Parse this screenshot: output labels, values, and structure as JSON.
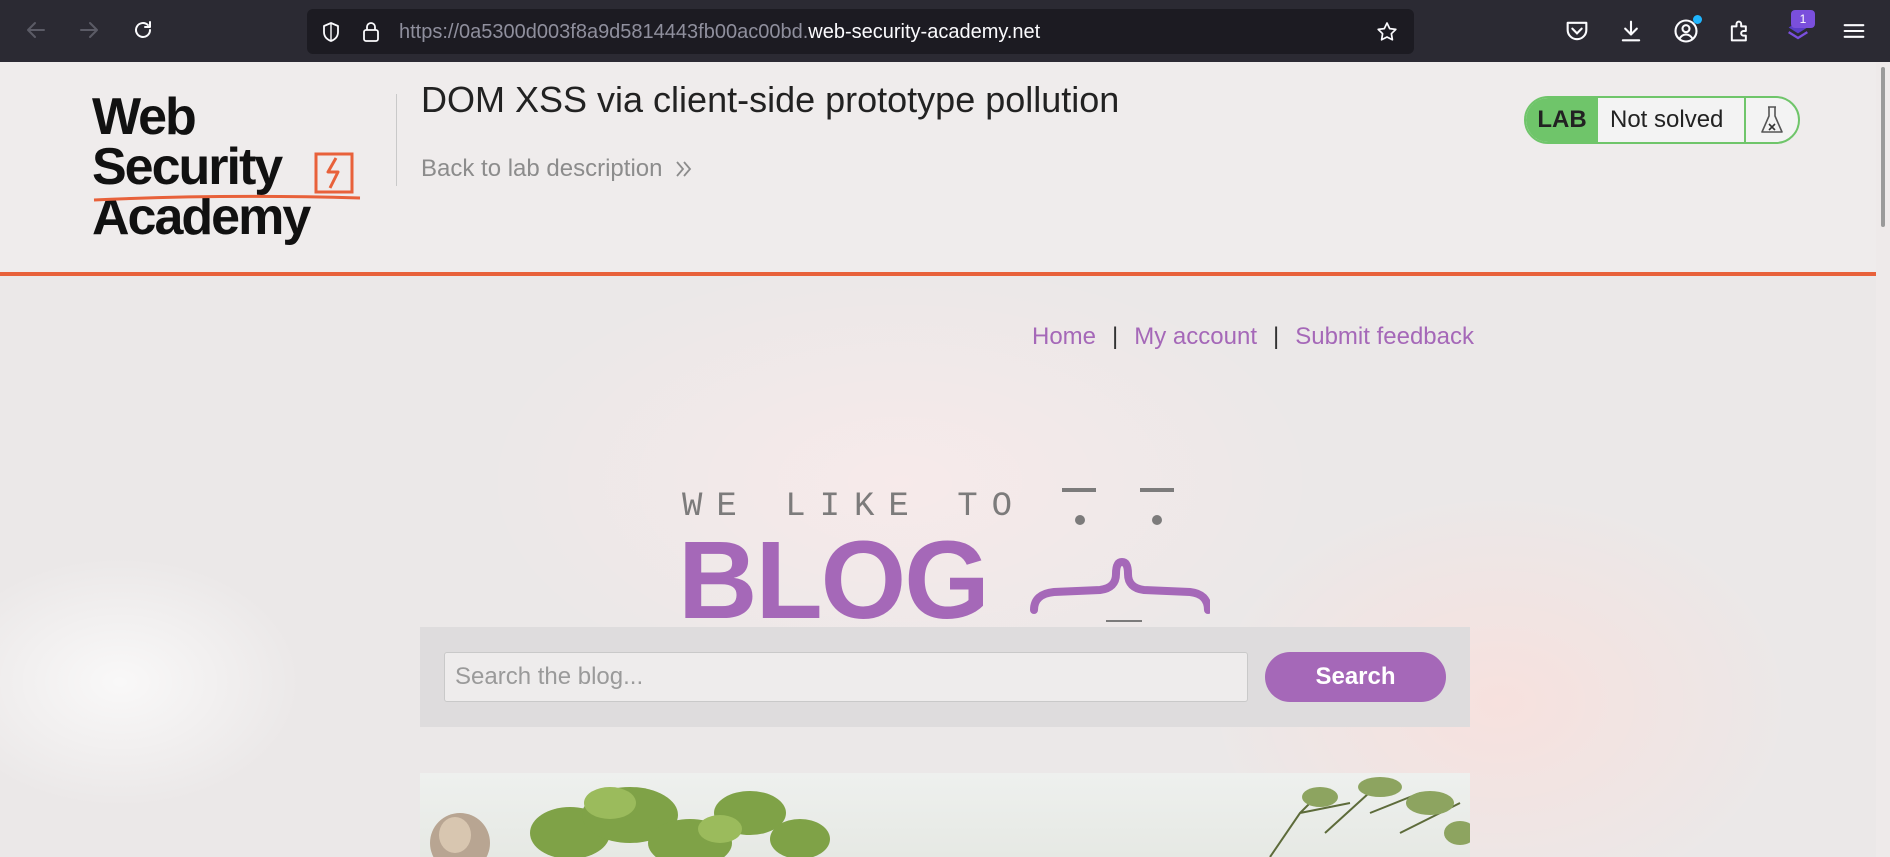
{
  "browser": {
    "url_prefix": "https://0a5300d003f8a9d5814443fb00ac00bd.",
    "url_host": "web-security-academy.net",
    "extensions_badge": "1"
  },
  "header": {
    "logo_line1": "Web Security",
    "logo_line2": "Academy",
    "lab_title": "DOM XSS via client-side prototype pollution",
    "back_link": "Back to lab description",
    "lab_badge": "LAB",
    "status": "Not solved",
    "accent_color": "#e8613a",
    "status_color": "#6fc56a"
  },
  "nav": {
    "home": "Home",
    "separator": "|",
    "my_account": "My account",
    "submit_feedback": "Submit feedback",
    "link_color": "#a568b8"
  },
  "banner": {
    "line1": "WE LIKE TO",
    "line2": "BLOG"
  },
  "search": {
    "placeholder": "Search the blog...",
    "value": "",
    "button_label": "Search"
  },
  "icons": {
    "back": "arrow-left-icon",
    "forward": "arrow-right-icon",
    "reload": "reload-icon",
    "shield": "shield-icon",
    "lock": "lock-icon",
    "bookmark": "star-icon",
    "pocket": "pocket-icon",
    "downloads": "download-icon",
    "account": "account-icon",
    "extensions": "puzzle-icon",
    "menu": "hamburger-icon",
    "flask": "flask-icon"
  }
}
